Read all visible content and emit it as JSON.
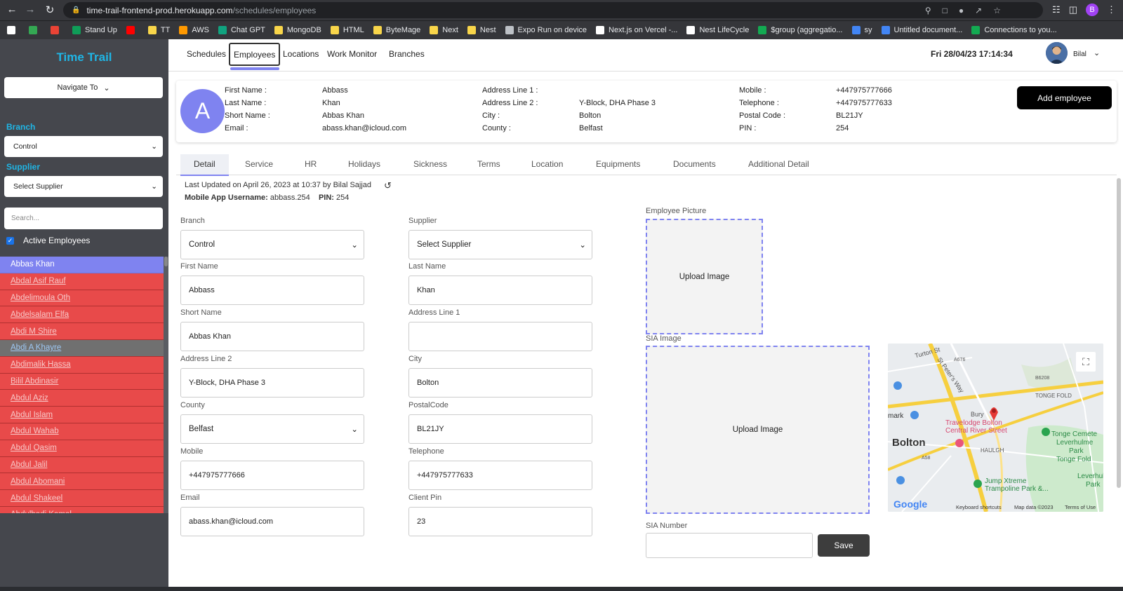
{
  "browser": {
    "url_host": "time-trail-frontend-prod.herokuapp.com",
    "url_path": "/schedules/employees",
    "profile_initial": "B",
    "bookmarks": [
      {
        "label": "",
        "color": "#ffffff"
      },
      {
        "label": "",
        "color": "#34a853"
      },
      {
        "label": "",
        "color": "#ea4335"
      },
      {
        "label": "Stand Up",
        "color": "#0f9d58"
      },
      {
        "label": "",
        "color": "#ff0000"
      },
      {
        "label": "TT",
        "color": "#f9d64a"
      },
      {
        "label": "AWS",
        "color": "#ff9900"
      },
      {
        "label": "Chat GPT",
        "color": "#10a37f"
      },
      {
        "label": "MongoDB",
        "color": "#f9d64a"
      },
      {
        "label": "HTML",
        "color": "#f9d64a"
      },
      {
        "label": "ByteMage",
        "color": "#f9d64a"
      },
      {
        "label": "Next",
        "color": "#f9d64a"
      },
      {
        "label": "Nest",
        "color": "#f9d64a"
      },
      {
        "label": "Expo Run on device",
        "color": "#bdc1c6"
      },
      {
        "label": "Next.js on Vercel -...",
        "color": "#ffffff"
      },
      {
        "label": "Nest LifeCycle",
        "color": "#ffffff"
      },
      {
        "label": "$group (aggregatio...",
        "color": "#13aa52"
      },
      {
        "label": "sy",
        "color": "#4285f4"
      },
      {
        "label": "Untitled document...",
        "color": "#4285f4"
      },
      {
        "label": "Connections to you...",
        "color": "#13aa52"
      }
    ]
  },
  "sidebar": {
    "brand": "Time Trail",
    "navigate_label": "Navigate To",
    "branch_label": "Branch",
    "branch_value": "Control",
    "supplier_label": "Supplier",
    "supplier_value": "Select Supplier",
    "search_placeholder": "Search...",
    "active_label": "Active Employees",
    "employees": [
      "Abbas Khan",
      "Abdal Asif Rauf",
      "Abdelimoula Oth",
      "Abdelsalam Elfa",
      "Abdi M Shire",
      "Abdi A Khayre",
      "Abdimalik Hassa",
      "Bilil Abdinasir",
      "Abdul Aziz",
      "Abdul Islam",
      "Abdul Wahab",
      "Abdul Qasim",
      "Abdul Jalil",
      "Abdul Abomani",
      "Abdul Shakeel",
      "Abdulhadi Kamal"
    ]
  },
  "topnav": {
    "items": [
      "Schedules",
      "Employees",
      "Locations",
      "Work Monitor",
      "Branches"
    ],
    "datetime": "Fri 28/04/23 17:14:34",
    "user": "Bilal"
  },
  "header": {
    "avatar_letter": "A",
    "col1": [
      {
        "k": "First Name :",
        "v": "Abbass"
      },
      {
        "k": "Last Name :",
        "v": "Khan"
      },
      {
        "k": "Short Name :",
        "v": "Abbas Khan"
      },
      {
        "k": "Email :",
        "v": "abass.khan@icloud.com"
      }
    ],
    "col2": [
      {
        "k": "Address Line 1 :",
        "v": ""
      },
      {
        "k": "Address Line 2 :",
        "v": "Y-Block, DHA Phase 3"
      },
      {
        "k": "City :",
        "v": "Bolton"
      },
      {
        "k": "County :",
        "v": "Belfast"
      }
    ],
    "col3": [
      {
        "k": "Mobile :",
        "v": "+447975777666"
      },
      {
        "k": "Telephone :",
        "v": "+447975777633"
      },
      {
        "k": "Postal Code :",
        "v": "BL21JY"
      },
      {
        "k": "PIN :",
        "v": "254"
      }
    ],
    "add_button": "Add employee"
  },
  "tabs": [
    "Detail",
    "Service",
    "HR",
    "Holidays",
    "Sickness",
    "Terms",
    "Location",
    "Equipments",
    "Documents",
    "Additional Detail"
  ],
  "meta": {
    "last_updated": "Last Updated on April 26, 2023 at 10:37 by Bilal Sajjad",
    "username_label": "Mobile App Username:",
    "username": "abbass.254",
    "pin_label": "PIN:",
    "pin": "254"
  },
  "form": {
    "branch": {
      "label": "Branch",
      "value": "Control"
    },
    "supplier": {
      "label": "Supplier",
      "value": "Select Supplier"
    },
    "first_name": {
      "label": "First Name",
      "value": "Abbass"
    },
    "last_name": {
      "label": "Last Name",
      "value": "Khan"
    },
    "short_name": {
      "label": "Short Name",
      "value": "Abbas Khan"
    },
    "address1": {
      "label": "Address Line 1",
      "value": ""
    },
    "address2": {
      "label": "Address Line 2",
      "value": "Y-Block, DHA Phase 3"
    },
    "city": {
      "label": "City",
      "value": "Bolton"
    },
    "county": {
      "label": "County",
      "value": "Belfast"
    },
    "postal": {
      "label": "PostalCode",
      "value": "BL21JY"
    },
    "mobile": {
      "label": "Mobile",
      "value": "+447975777666"
    },
    "telephone": {
      "label": "Telephone",
      "value": "+447975777633"
    },
    "email": {
      "label": "Email",
      "value": "abass.khan@icloud.com"
    },
    "client_pin": {
      "label": "Client Pin",
      "value": "23"
    },
    "employee_picture_label": "Employee Picture",
    "upload_text": "Upload Image",
    "sia_image_label": "SIA Image",
    "sia_number_label": "SIA Number",
    "save": "Save"
  },
  "map": {
    "labels": [
      "Turton St",
      "St Peter's Way",
      "Bury",
      "Travelodge Bolton",
      "Central River Street",
      "TONGE FOLD",
      "Tonge Cemete",
      "Leverhulme",
      "Park",
      "Tonge Fold",
      "HAULGH",
      "Bolton",
      "mark",
      "Jump Xtreme",
      "Trampoline Park &...",
      "Leverhul",
      "Park",
      "A676",
      "B6208",
      "A58"
    ],
    "google": "Google",
    "footer": [
      "Keyboard shortcuts",
      "Map data ©2023",
      "Terms of Use"
    ]
  }
}
